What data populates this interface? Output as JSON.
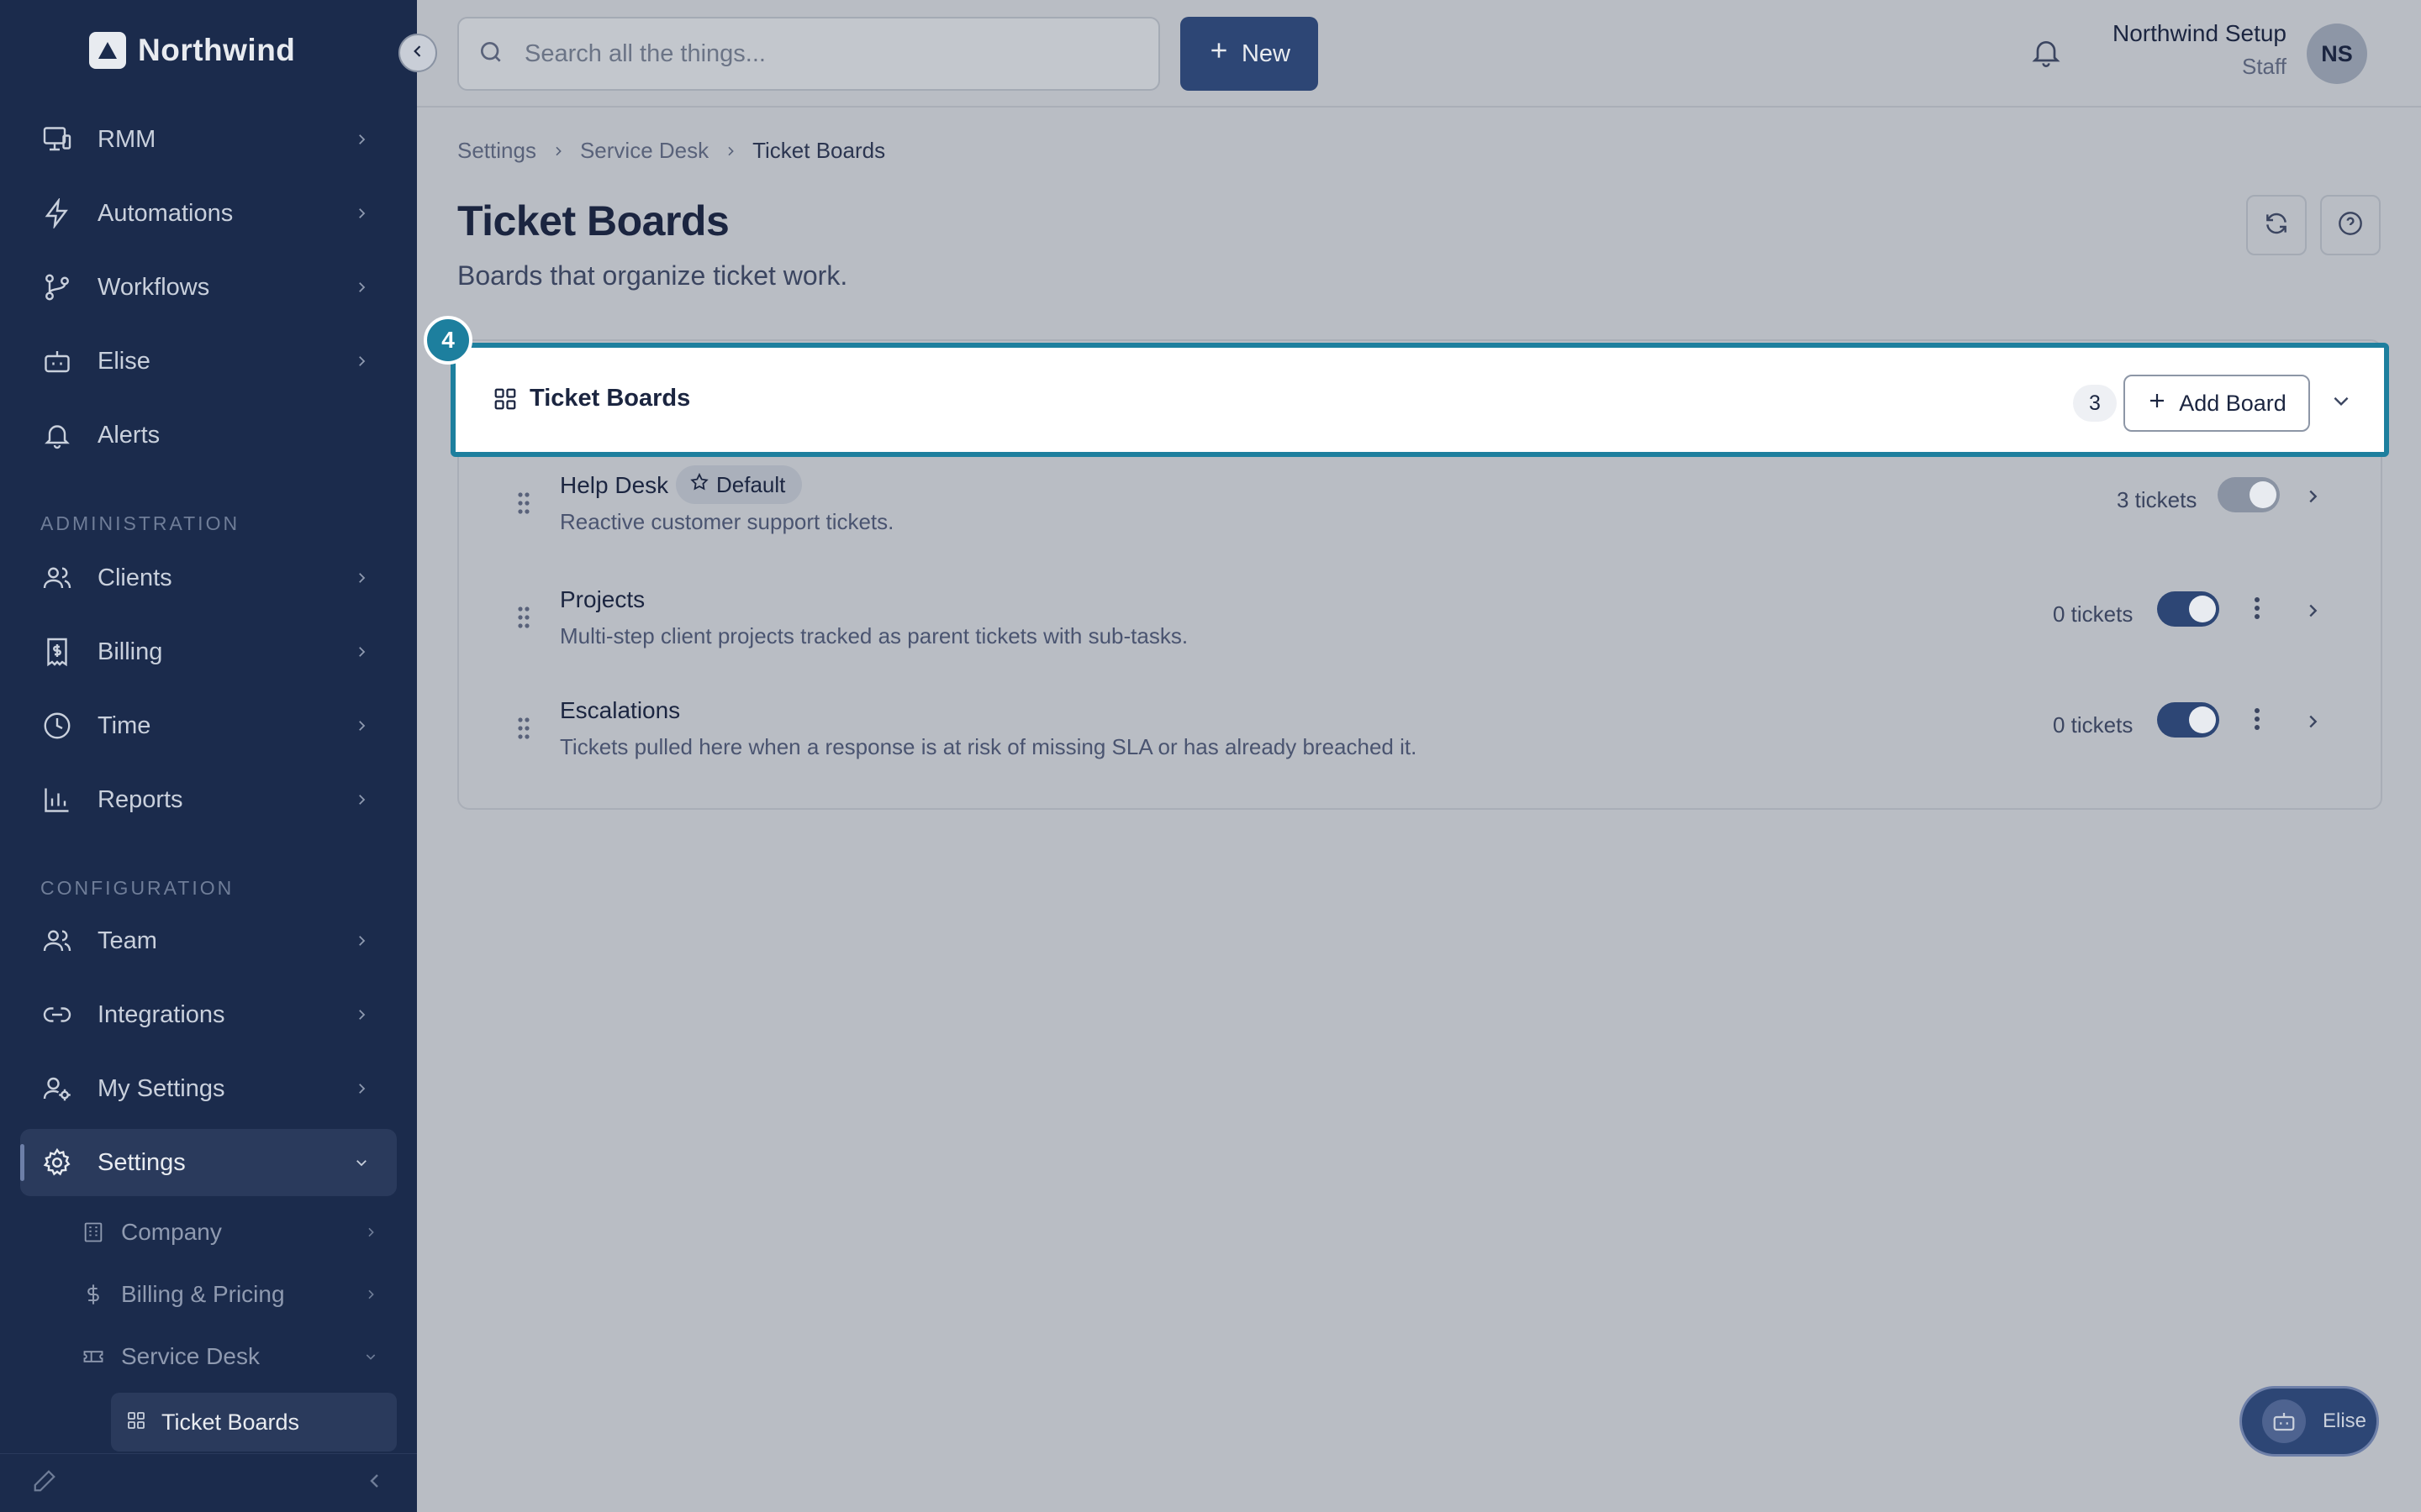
{
  "brand": {
    "name": "Northwind"
  },
  "sidebar": {
    "items": [
      {
        "label": "RMM",
        "icon": "monitor-icon"
      },
      {
        "label": "Automations",
        "icon": "bolt-icon"
      },
      {
        "label": "Workflows",
        "icon": "workflow-icon"
      },
      {
        "label": "Elise",
        "icon": "bot-icon"
      },
      {
        "label": "Alerts",
        "icon": "bell-icon"
      }
    ],
    "administration_label": "ADMINISTRATION",
    "admin_items": [
      {
        "label": "Clients",
        "icon": "users-icon"
      },
      {
        "label": "Billing",
        "icon": "receipt-icon"
      },
      {
        "label": "Time",
        "icon": "clock-icon"
      },
      {
        "label": "Reports",
        "icon": "bar-chart-icon"
      }
    ],
    "configuration_label": "CONFIGURATION",
    "config_items": [
      {
        "label": "Team",
        "icon": "users-icon"
      },
      {
        "label": "Integrations",
        "icon": "link-icon"
      },
      {
        "label": "My Settings",
        "icon": "user-cog-icon"
      },
      {
        "label": "Settings",
        "icon": "gear-icon"
      }
    ],
    "settings_sub": [
      {
        "label": "Company",
        "icon": "building-icon"
      },
      {
        "label": "Billing & Pricing",
        "icon": "dollar-icon"
      },
      {
        "label": "Service Desk",
        "icon": "ticket-icon"
      }
    ],
    "service_desk_sub": {
      "label": "Ticket Boards"
    }
  },
  "topbar": {
    "search_placeholder": "Search all the things...",
    "new_label": "New",
    "user_name": "Northwind Setup",
    "user_role": "Staff",
    "avatar_initials": "NS"
  },
  "breadcrumb": [
    "Settings",
    "Service Desk",
    "Ticket Boards"
  ],
  "page": {
    "title": "Ticket Boards",
    "subtitle": "Boards that organize ticket work."
  },
  "card": {
    "step": "4",
    "title": "Ticket Boards",
    "count": "3",
    "add_label": "Add Board",
    "boards": [
      {
        "name": "Help Desk",
        "badge": "Default",
        "desc": "Reactive customer support tickets.",
        "count": "3 tickets",
        "enabled": true,
        "locked": true
      },
      {
        "name": "Projects",
        "desc": "Multi-step client projects tracked as parent tickets with sub-tasks.",
        "count": "0 tickets",
        "enabled": true,
        "locked": false
      },
      {
        "name": "Escalations",
        "desc": "Tickets pulled here when a response is at risk of missing SLA or has already breached it.",
        "count": "0 tickets",
        "enabled": true,
        "locked": false
      }
    ]
  },
  "assistant": {
    "label": "Elise"
  },
  "colors": {
    "sidebar": "#1b2b4c",
    "accent": "#2d4675",
    "highlight": "#1d7f9e"
  }
}
